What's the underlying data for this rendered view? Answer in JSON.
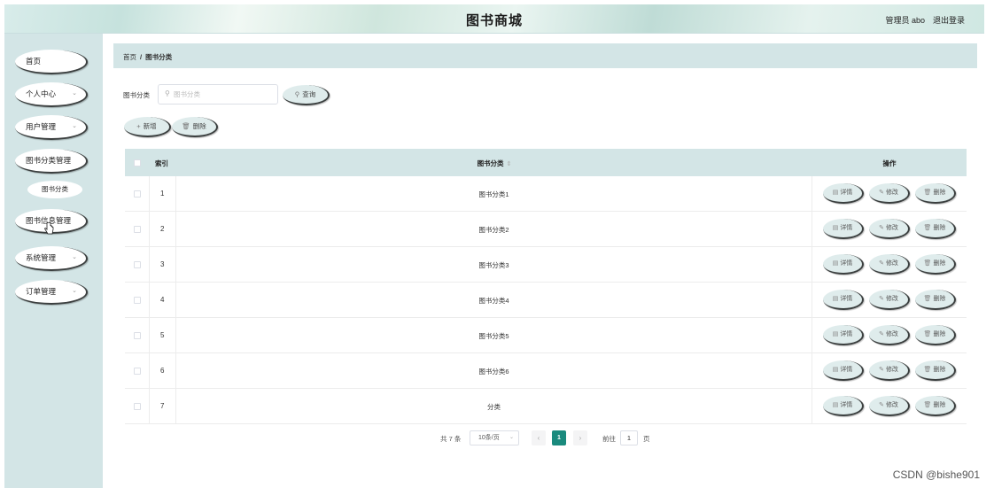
{
  "header": {
    "title": "图书商城",
    "user": "管理员 abo",
    "logout": "退出登录"
  },
  "sidebar": {
    "items": [
      {
        "label": "首页",
        "has_chevron": false
      },
      {
        "label": "个人中心",
        "has_chevron": true
      },
      {
        "label": "用户管理",
        "has_chevron": true
      },
      {
        "label": "图书分类管理",
        "has_chevron": false
      },
      {
        "label": "图书分类",
        "sub": true
      },
      {
        "label": "图书信息管理",
        "has_chevron": false
      },
      {
        "label": "系统管理",
        "has_chevron": true
      },
      {
        "label": "订单管理",
        "has_chevron": true
      }
    ],
    "chevron_icon": "chevron-down-icon"
  },
  "breadcrumb": {
    "home": "首页",
    "separator": "/",
    "current": "图书分类"
  },
  "search": {
    "label": "图书分类",
    "placeholder": "图书分类",
    "value": "",
    "query_button": "查询",
    "icon": "search-icon"
  },
  "actions": {
    "add": "新增",
    "delete": "删除"
  },
  "table": {
    "headers": {
      "index": "索引",
      "name": "图书分类",
      "ops": "操作"
    },
    "rows": [
      {
        "index": "1",
        "name": "图书分类1"
      },
      {
        "index": "2",
        "name": "图书分类2"
      },
      {
        "index": "3",
        "name": "图书分类3"
      },
      {
        "index": "4",
        "name": "图书分类4"
      },
      {
        "index": "5",
        "name": "图书分类5"
      },
      {
        "index": "6",
        "name": "图书分类6"
      },
      {
        "index": "7",
        "name": "分类"
      }
    ],
    "row_actions": {
      "detail": "详情",
      "edit": "修改",
      "delete": "删除"
    }
  },
  "pagination": {
    "total": "共 7 条",
    "page_size": "10条/页",
    "current_page": "1",
    "goto_label": "前往",
    "goto_value": "1",
    "unit": "页"
  },
  "watermark": "CSDN @bishe901",
  "colors": {
    "accent": "#1a8a7d",
    "panel": "#d3e5e6"
  }
}
